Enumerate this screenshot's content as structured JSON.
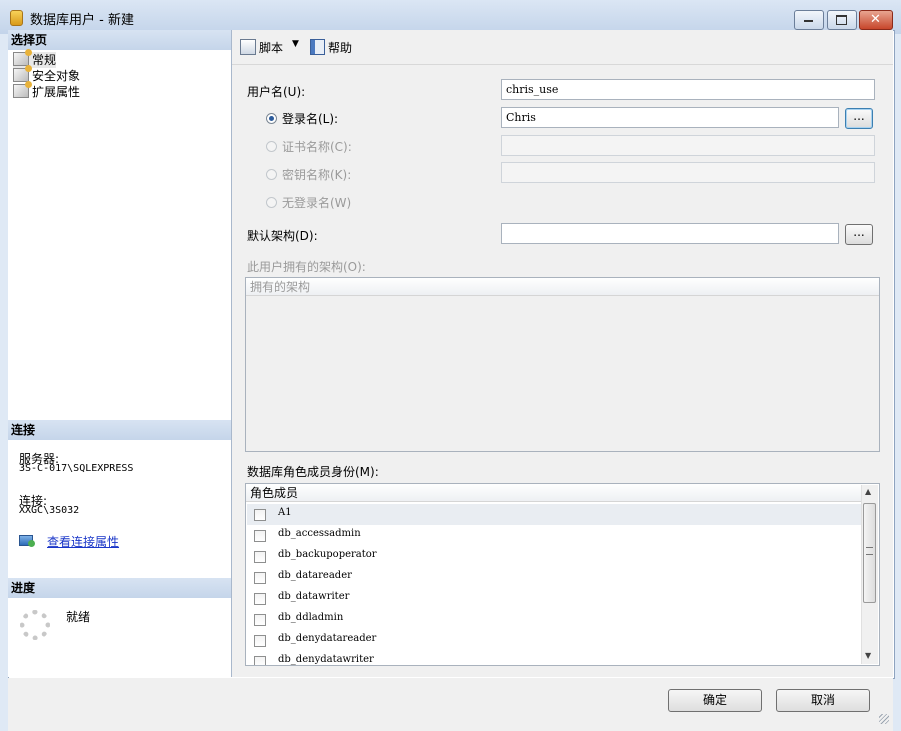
{
  "window": {
    "title": "数据库用户 - 新建"
  },
  "left": {
    "select_page_header": "选择页",
    "nav_items": [
      "常规",
      "安全对象",
      "扩展属性"
    ],
    "connection_header": "连接",
    "server_label": "服务器:",
    "server_value": "3S-C-017\\SQLEXPRESS",
    "connection_label": "连接:",
    "connection_value": "XXGC\\3S032",
    "view_connection_link": "查看连接属性",
    "progress_header": "进度",
    "progress_status": "就绪"
  },
  "toolbar": {
    "script_label": "脚本",
    "help_label": "帮助"
  },
  "form": {
    "username_label": "用户名(U):",
    "username_value": "chris_use",
    "login_name_label": "登录名(L):",
    "login_name_value": "Chris",
    "cert_name_label": "证书名称(C):",
    "key_name_label": "密钥名称(K):",
    "no_login_label": "无登录名(W)",
    "default_schema_label": "默认架构(D):",
    "default_schema_value": "",
    "browse_label": "...",
    "owned_schemas_label": "此用户拥有的架构(O):",
    "owned_schemas_column": "拥有的架构",
    "role_membership_label": "数据库角色成员身份(M):",
    "role_members_column": "角色成员",
    "roles": [
      "A1",
      "db_accessadmin",
      "db_backupoperator",
      "db_datareader",
      "db_datawriter",
      "db_ddladmin",
      "db_denydatareader",
      "db_denydatawriter"
    ]
  },
  "buttons": {
    "ok": "确定",
    "cancel": "取消"
  },
  "colors": {
    "accent": "#2c5b9b",
    "link": "#1a36c8",
    "header_bg": "#c5d5ea"
  }
}
